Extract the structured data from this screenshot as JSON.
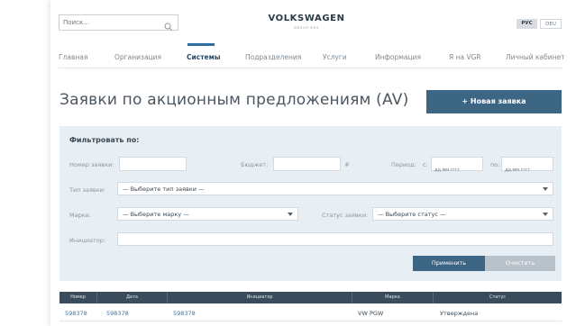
{
  "header": {
    "search_placeholder": "Поиск...",
    "brand": "VOLKSWAGEN",
    "brand_sub": "GROUP RUS",
    "lang_ru": "РУС",
    "lang_de": "DEU"
  },
  "nav": {
    "items": [
      {
        "label": "Главная"
      },
      {
        "label": "Организация"
      },
      {
        "label": "Системы"
      },
      {
        "label": "Подразделения"
      },
      {
        "label": "Услуги"
      },
      {
        "label": "Информация"
      },
      {
        "label": "Я на VGR"
      },
      {
        "label": "Личный кабинет"
      }
    ],
    "active": "Системы"
  },
  "page": {
    "title": "Заявки по акционным предложениям (AV)",
    "new_button": "+ Новая заявка"
  },
  "filter": {
    "title": "Фильтровать по:",
    "number_label": "Номер заявки:",
    "budget_label": "Бюджет:",
    "currency": "₽",
    "period_label": "Период:",
    "from_label": "с:",
    "to_label": "по:",
    "date_placeholder": "дд.мм.гггг",
    "type_label": "Тип заявки:",
    "type_value": "— Выберите тип заявки —",
    "brand_label": "Марка:",
    "brand_value": "— Выберите марку —",
    "status_label": "Статус заявки:",
    "status_value": "— Выберите статус —",
    "initiator_label": "Инициатор:",
    "apply": "Применить",
    "clear": "Очистить"
  },
  "table": {
    "columns": [
      "Номер",
      "Дата",
      "Инициатор",
      "Марка",
      "Статус"
    ],
    "rows": [
      [
        "598378",
        "598378",
        "598378",
        "VW PGW",
        "Утверждена"
      ]
    ]
  },
  "colors": {
    "accent": "#3d6685",
    "nav_active": "#2f6fa0",
    "panel": "#e8eff4",
    "table_header": "#3a4b5b",
    "link": "#3a78b0"
  }
}
